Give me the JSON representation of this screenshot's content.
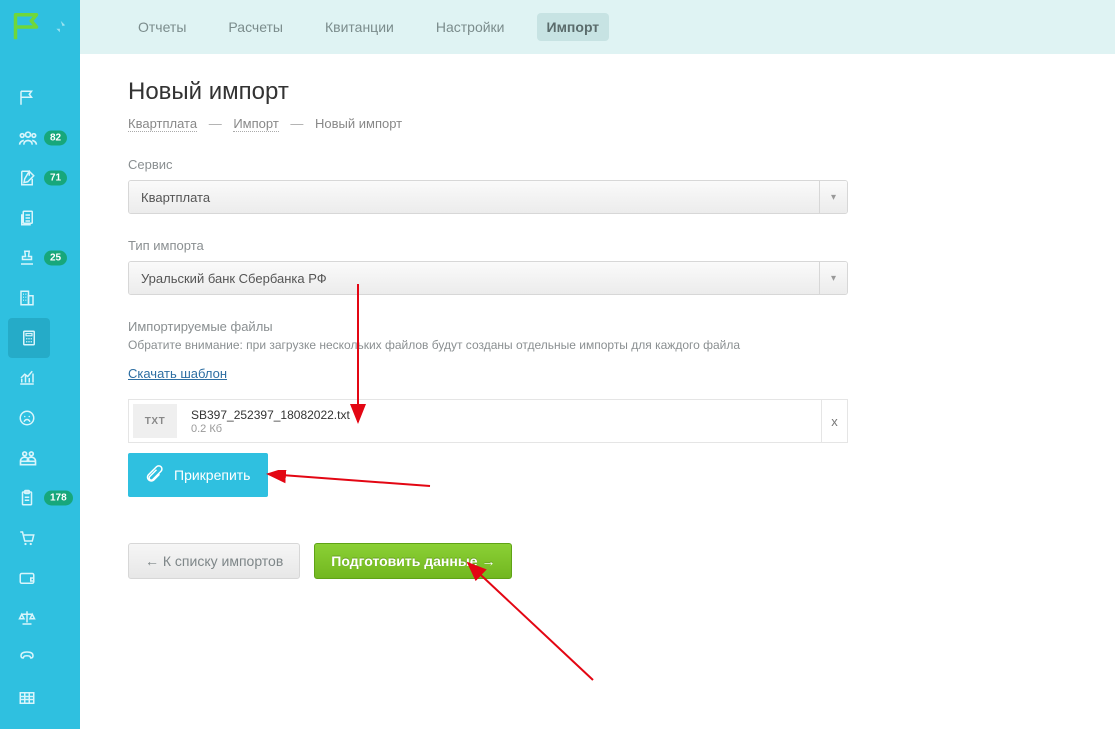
{
  "topbar": {
    "tabs": [
      "Отчеты",
      "Расчеты",
      "Квитанции",
      "Настройки",
      "Импорт"
    ],
    "active_index": 4
  },
  "sidebar": {
    "badges": {
      "idx1": "82",
      "idx2": "71",
      "idx4": "25",
      "idx10": "178"
    }
  },
  "page": {
    "title": "Новый импорт",
    "breadcrumb": {
      "root": "Квартплата",
      "mid": "Импорт",
      "current": "Новый импорт",
      "sep": "—"
    }
  },
  "form": {
    "service_label": "Сервис",
    "service_value": "Квартплата",
    "type_label": "Тип импорта",
    "type_value": "Уральский банк Сбербанка РФ",
    "files_label": "Импортируемые файлы",
    "files_hint": "Обратите внимание: при загрузке нескольких файлов будут созданы отдельные импорты для каждого файла",
    "download_template": "Скачать шаблон",
    "file": {
      "ext_badge": "TXT",
      "name": "SB397_252397_18082022.txt",
      "size": "0.2 Кб",
      "remove": "x"
    },
    "attach_label": "Прикрепить"
  },
  "actions": {
    "back": "← К списку импортов",
    "submit": "Подготовить данные →"
  }
}
